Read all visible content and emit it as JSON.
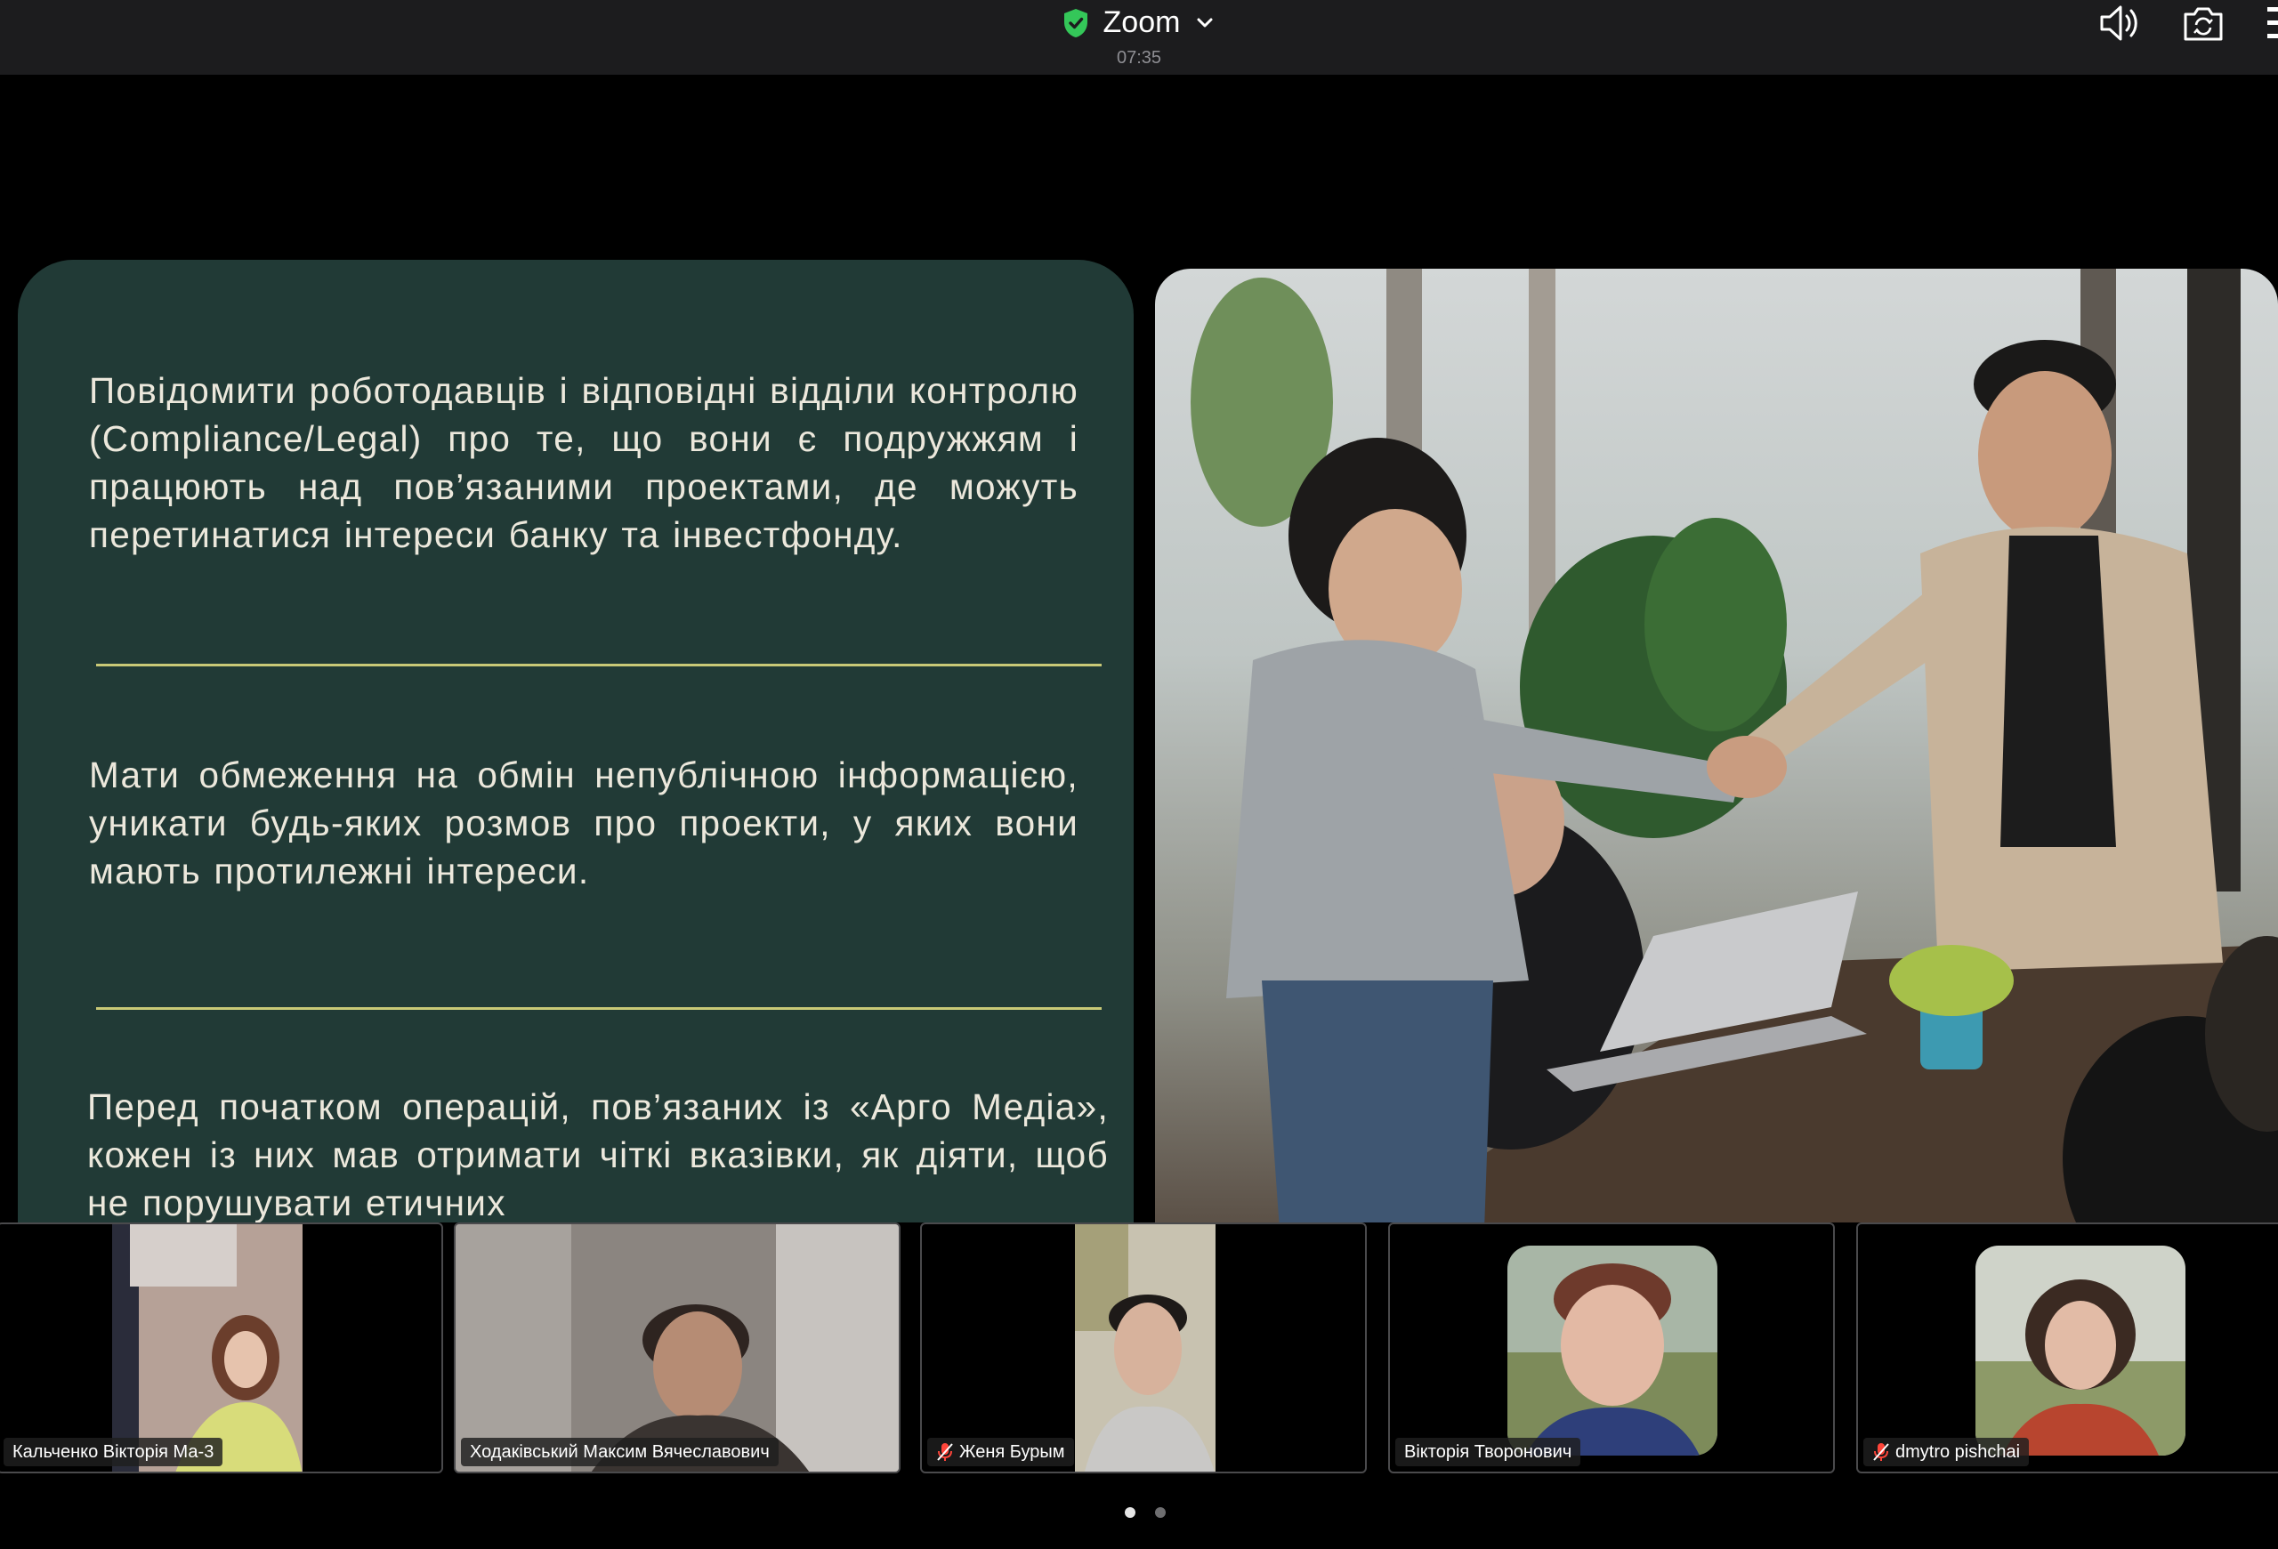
{
  "app": {
    "title": "Zoom",
    "time": "07:35"
  },
  "slide": {
    "paragraphs": [
      "Повідомити роботодавців і відповідні відділи контролю (Compliance/Legal) про те, що вони є подружжям і працюють над пов’язаними проектами, де можуть перетинатися інтереси банку та інвестфонду.",
      "Мати обмеження на обмін непублічною інформацією, уникати будь-яких розмов про проекти, у яких вони мають протилежні інтереси.",
      "Перед початком операцій, пов’язаних із «Арго Медіа», кожен із них мав отримати чіткі вказівки, як діяти, щоб не порушувати етичних"
    ]
  },
  "participants": [
    {
      "name": "Кальченко Вікторія Ма-3",
      "muted": false
    },
    {
      "name": "Ходаківський Максим Вячеславович",
      "muted": false
    },
    {
      "name": "Женя Бурым",
      "muted": true
    },
    {
      "name": "Вікторія Творонович",
      "muted": false
    },
    {
      "name": "dmytro pishchai",
      "muted": true
    }
  ],
  "pagination": {
    "pages": 2,
    "current": 1
  },
  "colors": {
    "slide_bg": "#213a36",
    "slide_text": "#ece8dc",
    "divider": "#c9c977",
    "secure": "#34c759"
  }
}
